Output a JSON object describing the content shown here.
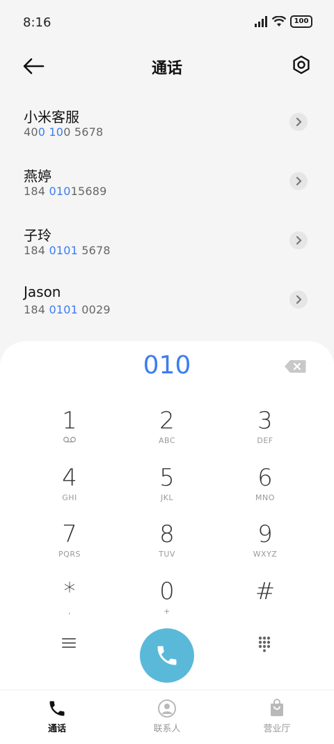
{
  "status_bar": {
    "time": "8:16",
    "battery": "100"
  },
  "header": {
    "title": "通话"
  },
  "contacts": [
    {
      "name": "小米客服",
      "number_parts": [
        "40",
        "0 10",
        "0 5678"
      ]
    },
    {
      "name": "燕婷",
      "number_parts": [
        "184 ",
        "010",
        "15689"
      ]
    },
    {
      "name": "子玲",
      "number_parts": [
        "184 ",
        "0101",
        " 5678"
      ]
    },
    {
      "name": "Jason",
      "number_parts": [
        "184 ",
        "0101",
        " 0029"
      ]
    }
  ],
  "dialpad": {
    "number": "010",
    "keys": [
      {
        "digit": "1",
        "sub": ""
      },
      {
        "digit": "2",
        "sub": "ABC"
      },
      {
        "digit": "3",
        "sub": "DEF"
      },
      {
        "digit": "4",
        "sub": "GHI"
      },
      {
        "digit": "5",
        "sub": "JKL"
      },
      {
        "digit": "6",
        "sub": "MNO"
      },
      {
        "digit": "7",
        "sub": "PQRS"
      },
      {
        "digit": "8",
        "sub": "TUV"
      },
      {
        "digit": "9",
        "sub": "WXYZ"
      },
      {
        "digit": "*",
        "sub": ","
      },
      {
        "digit": "0",
        "sub": "+"
      },
      {
        "digit": "#",
        "sub": ""
      }
    ]
  },
  "bottom_nav": {
    "calls": "通话",
    "contacts": "联系人",
    "service": "营业厅"
  },
  "colors": {
    "accent": "#3c7cf0",
    "call_button": "#5ab9d9"
  }
}
